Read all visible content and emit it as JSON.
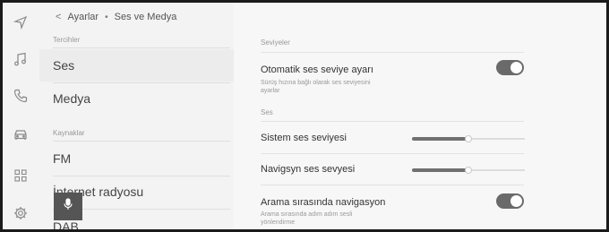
{
  "rail": {
    "icons": [
      "navigation-icon",
      "music-icon",
      "phone-icon",
      "car-icon",
      "apps-grid-icon",
      "settings-gear-icon"
    ]
  },
  "header": {
    "back_glyph": "<",
    "breadcrumb_parent": "Ayarlar",
    "breadcrumb_separator": "•",
    "breadcrumb_current": "Ses ve Medya"
  },
  "list": {
    "preferences_label": "Tercihler",
    "preferences": [
      "Ses",
      "Medya"
    ],
    "sources_label": "Kaynaklar",
    "sources": [
      "FM",
      "İnternet radyosu",
      "DAB"
    ],
    "selected": "Ses"
  },
  "content": {
    "levels_label": "Seviyeler",
    "auto_level": {
      "title": "Otomatik ses seviye ayarı",
      "subtitle": "Sürüş hızına bağlı olarak ses seviyesini ayarlar",
      "enabled": true
    },
    "sound_label": "Ses",
    "system_volume": {
      "title": "Sistem ses seviyesi",
      "level": 0.5
    },
    "nav_volume": {
      "title": "Navigsyn ses sevyesi",
      "level": 0.5
    },
    "nav_during_call": {
      "title": "Arama sırasında navigasyon",
      "subtitle": "Arama sırasında adım adım sesli yönlendirme",
      "enabled": true
    }
  },
  "colors": {
    "panel_bg": "#f3f3f3",
    "content_bg": "#f7f7f7",
    "selected_row": "#ececec",
    "toggle_on": "#6a6a6a",
    "mic_button": "#555555"
  }
}
